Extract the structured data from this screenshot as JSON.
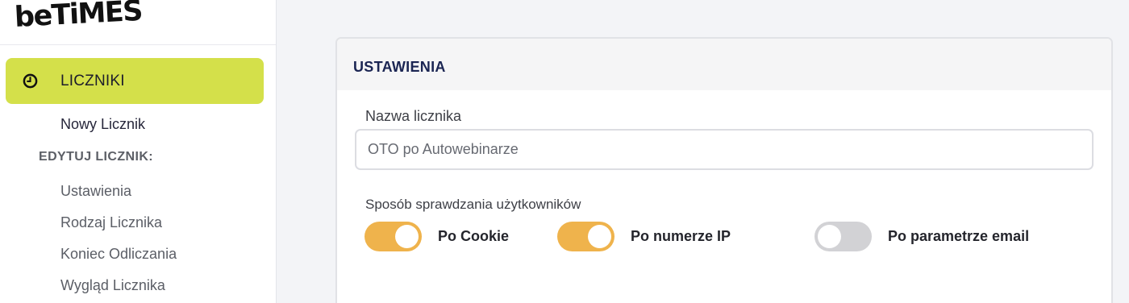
{
  "brand": {
    "logo_text": "beTiMES"
  },
  "sidebar": {
    "active_item": {
      "label": "LICZNIKI",
      "icon": "clock-icon"
    },
    "new_counter": "Nowy Licznik",
    "edit_section_label": "EDYTUJ LICZNIK:",
    "edit_items": [
      {
        "label": "Ustawienia"
      },
      {
        "label": "Rodzaj Licznika"
      },
      {
        "label": "Koniec Odliczania"
      },
      {
        "label": "Wygląd Licznika"
      }
    ]
  },
  "settings": {
    "title": "USTAWIENIA",
    "name_label": "Nazwa licznika",
    "name_value": "OTO po Autowebinarze",
    "method_label": "Sposób sprawdzania użytkowników",
    "toggles": [
      {
        "label": "Po Cookie",
        "on": true
      },
      {
        "label": "Po numerze IP",
        "on": true
      },
      {
        "label": "Po parametrze email",
        "on": false
      }
    ]
  },
  "colors": {
    "accent_active_nav": "#d4e04a",
    "toggle_on": "#efb34c",
    "toggle_off": "#d2d2d5",
    "title_navy": "#1b2553"
  }
}
